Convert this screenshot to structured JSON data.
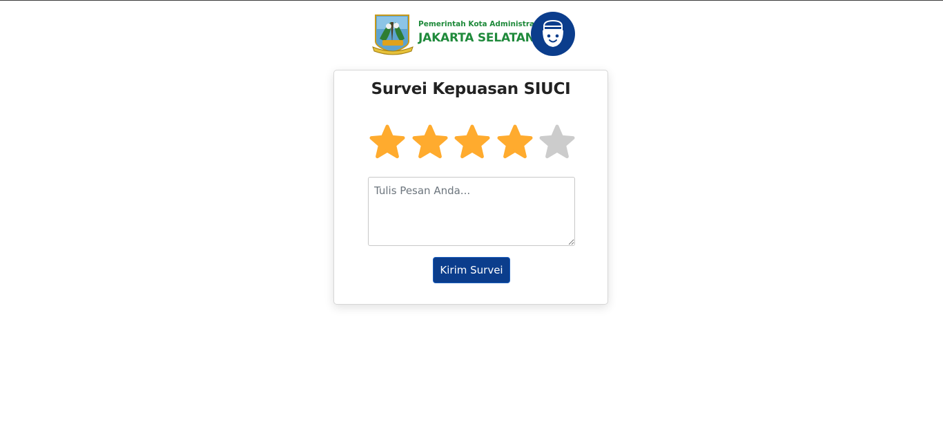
{
  "header": {
    "subtitle": "Pemerintah Kota Administrasi",
    "title": "JAKARTA SELATAN",
    "brand_color": "#1f8a3b",
    "crest_icon": "jakarta-selatan-crest-icon",
    "mascot_icon": "mascot-face-icon",
    "mascot_color": "#0b3d8c"
  },
  "survey": {
    "title": "Survei Kepuasan SIUCI",
    "rating": 4,
    "max_rating": 5,
    "star_active_color": "#ffab2e",
    "star_inactive_color": "#cccccc",
    "message_value": "",
    "message_placeholder": "Tulis Pesan Anda...",
    "submit_label": "Kirim Survei",
    "submit_color": "#0b3d8c"
  }
}
